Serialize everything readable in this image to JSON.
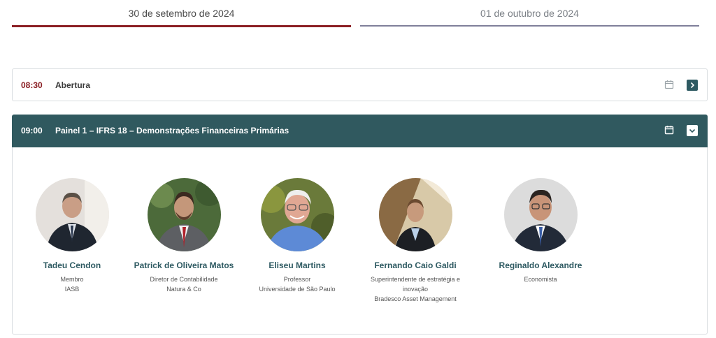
{
  "tabs": [
    {
      "label": "30 de setembro de 2024",
      "active": true
    },
    {
      "label": "01 de outubro de 2024",
      "active": false
    }
  ],
  "sessions": [
    {
      "time": "08:30",
      "title": "Abertura",
      "expanded": false
    },
    {
      "time": "09:00",
      "title": "Painel 1 – IFRS 18 – Demonstrações Financeiras Primárias",
      "expanded": true,
      "speakers": [
        {
          "name": "Tadeu Cendon",
          "info": [
            "Membro",
            "IASB"
          ]
        },
        {
          "name": "Patrick de Oliveira Matos",
          "info": [
            "Diretor de Contabilidade",
            "Natura & Co"
          ]
        },
        {
          "name": "Eliseu Martins",
          "info": [
            "Professor",
            "Universidade de São Paulo"
          ]
        },
        {
          "name": "Fernando Caio Galdi",
          "info": [
            "Superintendente de estratégia e",
            "inovação",
            "Bradesco Asset Management"
          ]
        },
        {
          "name": "Reginaldo Alexandre",
          "info": [
            "Economista"
          ]
        }
      ]
    }
  ],
  "colors": {
    "accent": "#8b1f24",
    "teal": "#30595f",
    "inactive_tab": "#7f7f9a"
  },
  "icons": {
    "calendar": "calendar-icon",
    "expand": "chevron-right-icon",
    "collapse": "chevron-down-icon"
  }
}
